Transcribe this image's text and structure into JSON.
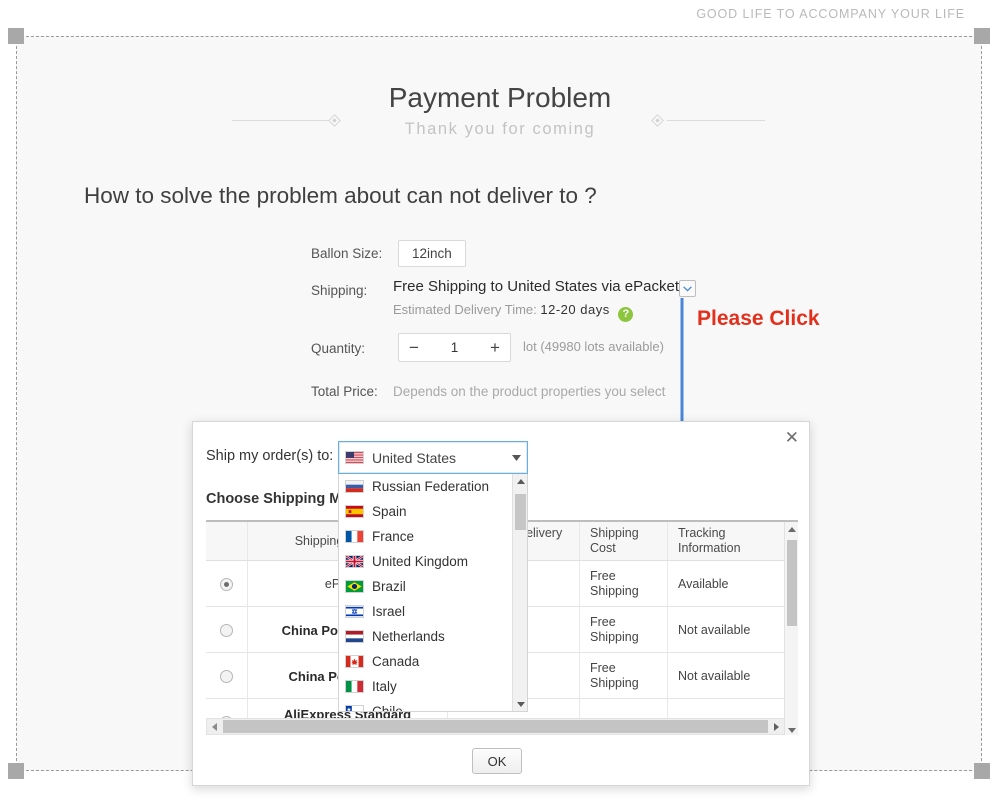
{
  "banner": {
    "text": "GOOD LIFE TO ACCOMPANY YOUR LIFE"
  },
  "header": {
    "title": "Payment Problem",
    "subtitle": "Thank you for coming",
    "question": "How to solve the problem about can not deliver to ?"
  },
  "product": {
    "size_label": "Ballon Size:",
    "size_value": "12inch",
    "shipping_label": "Shipping:",
    "shipping_value": "Free Shipping to United States via ePacket",
    "eta_prefix": "Estimated Delivery Time:",
    "eta_value": "12-20 days",
    "help_icon": "?",
    "quantity_label": "Quantity:",
    "quantity_minus": "−",
    "quantity_value": "1",
    "quantity_plus": "+",
    "quantity_note": "lot (49980 lots available)",
    "total_label": "Total Price:",
    "total_value": "Depends on the product properties you select"
  },
  "annotation": {
    "text": "Please Click",
    "color": "#e2301c",
    "arrow_color": "#4a86d8"
  },
  "modal": {
    "close_label": "✕",
    "ship_to_label": "Ship my order(s) to:",
    "choose_label": "Choose Shipping Method:",
    "ok_label": "OK",
    "table": {
      "headers": [
        "",
        "Shipping Company",
        "Estimated Delivery Time",
        "Shipping Cost",
        "Tracking Information"
      ],
      "rows": [
        {
          "selected": true,
          "company": "ePacket",
          "bold": false,
          "time": "",
          "cost": "Free Shipping",
          "tracking": "Available"
        },
        {
          "selected": false,
          "company": "China Post Air Parcel",
          "bold": true,
          "time": "",
          "cost": "Free Shipping",
          "tracking": "Not available"
        },
        {
          "selected": false,
          "company": "China Post Air Mail",
          "bold": true,
          "time": "",
          "cost": "Free Shipping",
          "tracking": "Not available"
        },
        {
          "selected": false,
          "company": "AliExpress Standard Shipping",
          "bold": true,
          "time": "",
          "cost": "",
          "tracking": ""
        }
      ]
    }
  },
  "country_dropdown": {
    "selected": "United States",
    "selected_flag": "us",
    "caret_icon": "▼",
    "options": [
      {
        "label": "Russian Federation",
        "flag": "ru"
      },
      {
        "label": "Spain",
        "flag": "es"
      },
      {
        "label": "France",
        "flag": "fr"
      },
      {
        "label": "United Kingdom",
        "flag": "gb"
      },
      {
        "label": "Brazil",
        "flag": "br"
      },
      {
        "label": "Israel",
        "flag": "il"
      },
      {
        "label": "Netherlands",
        "flag": "nl"
      },
      {
        "label": "Canada",
        "flag": "ca"
      },
      {
        "label": "Italy",
        "flag": "it"
      },
      {
        "label": "Chile",
        "flag": "cl"
      }
    ]
  },
  "colors": {
    "accent_green": "#8cc63e",
    "annotation_red": "#e2301c",
    "arrow_blue": "#4a86d8",
    "focus_blue": "#6aaee0"
  }
}
